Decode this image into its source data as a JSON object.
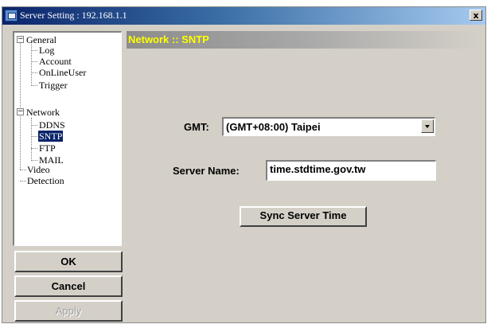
{
  "window": {
    "title": "Server Setting : 192.168.1.1",
    "close_label": "x"
  },
  "tree": {
    "items": [
      {
        "label": "General",
        "level": 0,
        "expanded": true
      },
      {
        "label": "Log",
        "level": 1
      },
      {
        "label": "Account",
        "level": 1
      },
      {
        "label": "OnLineUser",
        "level": 1
      },
      {
        "label": "Trigger",
        "level": 1
      },
      {
        "label": "Network",
        "level": 0,
        "expanded": true
      },
      {
        "label": "DDNS",
        "level": 1
      },
      {
        "label": "SNTP",
        "level": 1,
        "selected": true
      },
      {
        "label": "FTP",
        "level": 1
      },
      {
        "label": "MAIL",
        "level": 1
      },
      {
        "label": "Video",
        "level": 0
      },
      {
        "label": "Detection",
        "level": 0
      }
    ],
    "expanded_glyph": "−"
  },
  "buttons": {
    "ok_label": "OK",
    "cancel_label": "Cancel",
    "apply_label": "Apply",
    "apply_enabled": false
  },
  "panel": {
    "title": "Network :: SNTP",
    "gmt_label": "GMT:",
    "gmt_value": "(GMT+08:00) Taipei",
    "server_name_label": "Server Name:",
    "server_name_value": "time.stdtime.gov.tw",
    "sync_button_label": "Sync Server Time"
  },
  "colors": {
    "title_bar_start": "#0a246a",
    "panel_title_text": "#ffff00",
    "selection": "#0a246a"
  }
}
